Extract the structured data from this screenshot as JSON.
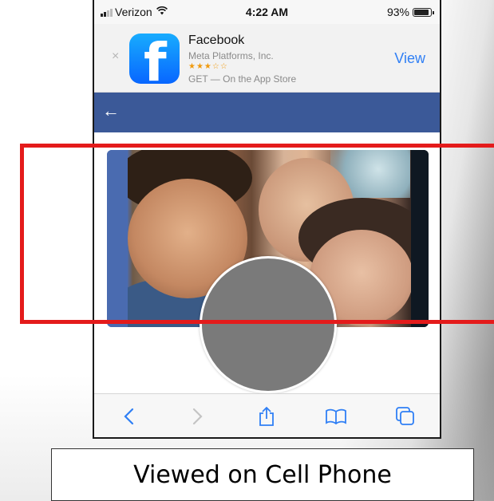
{
  "status_bar": {
    "carrier": "Verizon",
    "time": "4:22 AM",
    "battery": "93%",
    "icons": [
      "signal-icon",
      "wifi-icon",
      "battery-icon"
    ]
  },
  "app_banner": {
    "close_glyph": "×",
    "app_name": "Facebook",
    "publisher": "Meta Platforms, Inc.",
    "rating_stars": "★★★☆☆",
    "get_text": "GET — On the App Store",
    "view_label": "View",
    "logo_letter": "f"
  },
  "fb_header": {
    "back_glyph": "←",
    "color": "#3b5998"
  },
  "toolbar": {
    "buttons": [
      "back-icon",
      "forward-icon",
      "share-icon",
      "bookmarks-icon",
      "tabs-icon"
    ],
    "accent": "#2f7ff5"
  },
  "annotation": {
    "highlight_color": "#e41b1b",
    "caption": "Viewed on Cell Phone"
  }
}
